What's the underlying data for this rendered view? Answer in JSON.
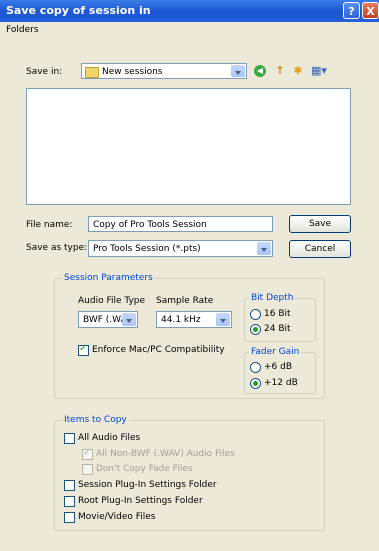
{
  "window": {
    "title": "Save copy of session in",
    "help_glyph": "?",
    "close_glyph": "X"
  },
  "menubar": {
    "folders": "Folders"
  },
  "save_in": {
    "label": "Save in:",
    "value": "New sessions"
  },
  "toolbar": {
    "back_glyph": "◀",
    "up_glyph": "↑",
    "new_folder_glyph": "✱",
    "views_glyph": "▦▾"
  },
  "file_name": {
    "label": "File name:",
    "value": "Copy of Pro Tools Session"
  },
  "save_as_type": {
    "label": "Save as type:",
    "value": "Pro Tools Session (*.pts)"
  },
  "buttons": {
    "save": "Save",
    "cancel": "Cancel"
  },
  "session_parameters": {
    "title": "Session Parameters",
    "audio_file_type_label": "Audio File Type",
    "audio_file_type_value": "BWF (.WA",
    "sample_rate_label": "Sample Rate",
    "sample_rate_value": "44.1 kHz",
    "bit_depth": {
      "title": "Bit Depth",
      "opt16": "16 Bit",
      "opt24": "24 Bit",
      "selected": "24 Bit"
    },
    "enforce_label": "Enforce Mac/PC Compatibility",
    "enforce_checked": true,
    "fader_gain": {
      "title": "Fader Gain",
      "opt6": "+6 dB",
      "opt12": "+12 dB",
      "selected": "+12 dB"
    }
  },
  "items_to_copy": {
    "title": "Items to Copy",
    "all_audio": "All Audio Files",
    "all_non_bwf": "All Non-BWF (.WAV) Audio Files",
    "dont_copy_fade": "Don't Copy Fade Files",
    "session_plugin": "Session Plug-In Settings Folder",
    "root_plugin": "Root Plug-In Settings Folder",
    "movie_video": "Movie/Video Files"
  }
}
